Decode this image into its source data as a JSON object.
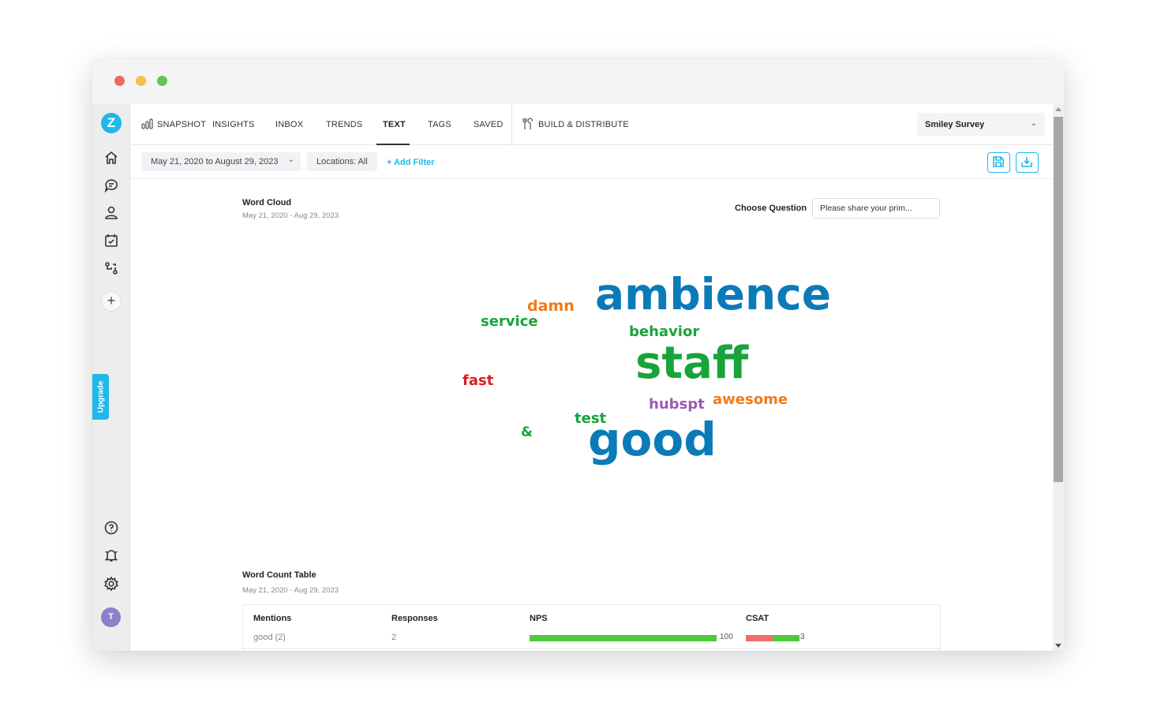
{
  "window": {
    "controls": [
      "close",
      "minimize",
      "maximize"
    ]
  },
  "sidebar": {
    "logo": "Z",
    "items": [
      {
        "name": "home",
        "icon": "home-icon"
      },
      {
        "name": "conversations",
        "icon": "chat-bubbles-icon"
      },
      {
        "name": "contacts",
        "icon": "user-icon"
      },
      {
        "name": "tasks",
        "icon": "calendar-check-icon"
      },
      {
        "name": "workflows",
        "icon": "workflow-icon"
      }
    ],
    "add_label": "+",
    "upgrade_label": "Upgrade",
    "bottom_items": [
      {
        "name": "help",
        "icon": "help-icon"
      },
      {
        "name": "notifications",
        "icon": "bell-icon"
      },
      {
        "name": "settings",
        "icon": "gear-icon"
      }
    ],
    "avatar_initial": "T"
  },
  "nav": {
    "tabs": [
      {
        "label": "SNAPSHOT",
        "active": false
      },
      {
        "label": "INSIGHTS",
        "active": false
      },
      {
        "label": "INBOX",
        "active": false
      },
      {
        "label": "TRENDS",
        "active": false
      },
      {
        "label": "TEXT",
        "active": true
      },
      {
        "label": "TAGS",
        "active": false
      },
      {
        "label": "SAVED",
        "active": false
      }
    ],
    "build_label": "BUILD & DISTRIBUTE",
    "survey_select": "Smiley Survey"
  },
  "filters": {
    "date_range": "May 21, 2020 to August 29, 2023",
    "locations": "Locations: All",
    "add_filter": "+ Add Filter"
  },
  "word_cloud": {
    "title": "Word Cloud",
    "date_range": "May 21, 2020 - Aug 29, 2023",
    "choose_question_label": "Choose Question",
    "question_value": "Please share your prim...",
    "colors": {
      "blue": "#0a7bb8",
      "green": "#17a43a",
      "orange": "#f27a1a",
      "red": "#e01b1b",
      "purple": "#9b59b6"
    },
    "words": [
      {
        "text": "ambience",
        "color": "blue"
      },
      {
        "text": "damn",
        "color": "orange"
      },
      {
        "text": "service",
        "color": "green"
      },
      {
        "text": "behavior",
        "color": "green"
      },
      {
        "text": "staff",
        "color": "green"
      },
      {
        "text": "fast",
        "color": "red"
      },
      {
        "text": "hubspt",
        "color": "purple"
      },
      {
        "text": "awesome",
        "color": "orange"
      },
      {
        "text": "test",
        "color": "green"
      },
      {
        "text": "&",
        "color": "green"
      },
      {
        "text": "good",
        "color": "blue"
      }
    ]
  },
  "word_count_table": {
    "title": "Word Count Table",
    "date_range": "May 21, 2020 - Aug 29, 2023",
    "columns": [
      "Mentions",
      "Responses",
      "NPS",
      "CSAT"
    ],
    "rows": [
      {
        "mention": "good (2)",
        "responses": "2",
        "nps": "100",
        "nps_fraction": 1.0,
        "csat": "3",
        "csat_negative_fraction": 0.5,
        "csat_positive_fraction": 0.5
      }
    ]
  },
  "colors": {
    "accent": "#1fb8e8",
    "positive": "#4bcb3a",
    "negative": "#f26c6c"
  }
}
